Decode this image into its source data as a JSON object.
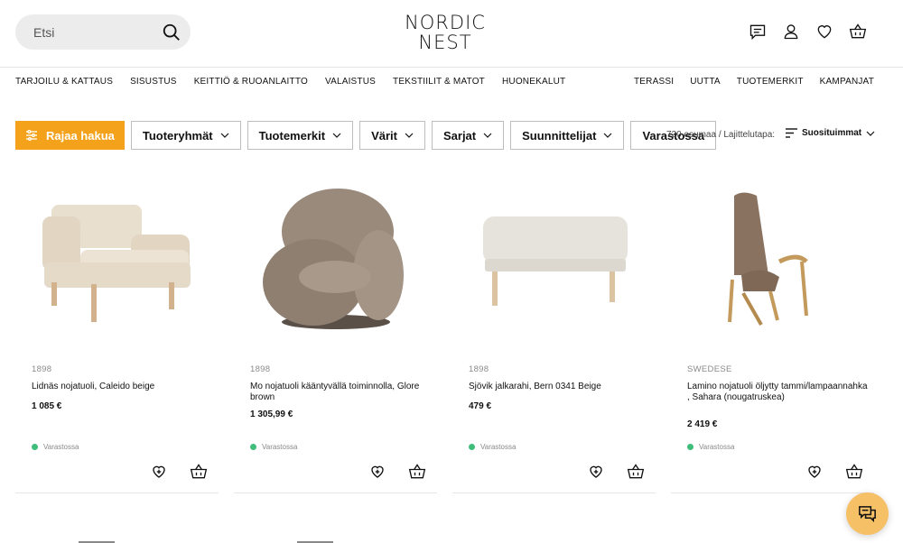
{
  "header": {
    "search_placeholder": "Etsi",
    "logo_line1": "NORDIC",
    "logo_line2": "NEST",
    "icons": [
      "chat-icon",
      "user-icon",
      "heart-icon",
      "basket-icon"
    ]
  },
  "nav": {
    "left": [
      "TARJOILU & KATTAUS",
      "SISUSTUS",
      "KEITTIÖ & RUOANLAITTO",
      "VALAISTUS",
      "TEKSTIILIT & MATOT",
      "HUONEKALUT"
    ],
    "right": [
      "TERASSI",
      "UUTTA",
      "TUOTEMERKIT",
      "KAMPANJAT"
    ]
  },
  "filters": {
    "primary_label": "Rajaa hakua",
    "buttons": [
      "Tuoteryhmät",
      "Tuotemerkit",
      "Värit",
      "Sarjat",
      "Suunnittelijat"
    ],
    "stock_label": "Varastossa",
    "results_text": "720 osumaa / Lajittelutapa:",
    "sort_label": "Suosituimmat"
  },
  "products": [
    {
      "brand": "1898",
      "name": "Lidnäs nojatuoli, Caleido beige",
      "price": "1 085 €",
      "stock": "Varastossa"
    },
    {
      "brand": "1898",
      "name": "Mo nojatuoli kääntyvällä toiminnolla, Glore brown",
      "price": "1 305,99 €",
      "stock": "Varastossa"
    },
    {
      "brand": "1898",
      "name": "Sjövik jalkarahi, Bern 0341 Beige",
      "price": "479 €",
      "stock": "Varastossa"
    },
    {
      "brand": "SWEDESE",
      "name": "Lamino nojatuoli öljytty tammi/lampaannahka , Sahara (nougatruskea)",
      "price": "2 419 €",
      "stock": "Varastossa"
    }
  ],
  "colors": {
    "accent": "#f4a21c",
    "stock_dot": "#3ebd7b",
    "chat_bubble": "#f6c067"
  }
}
